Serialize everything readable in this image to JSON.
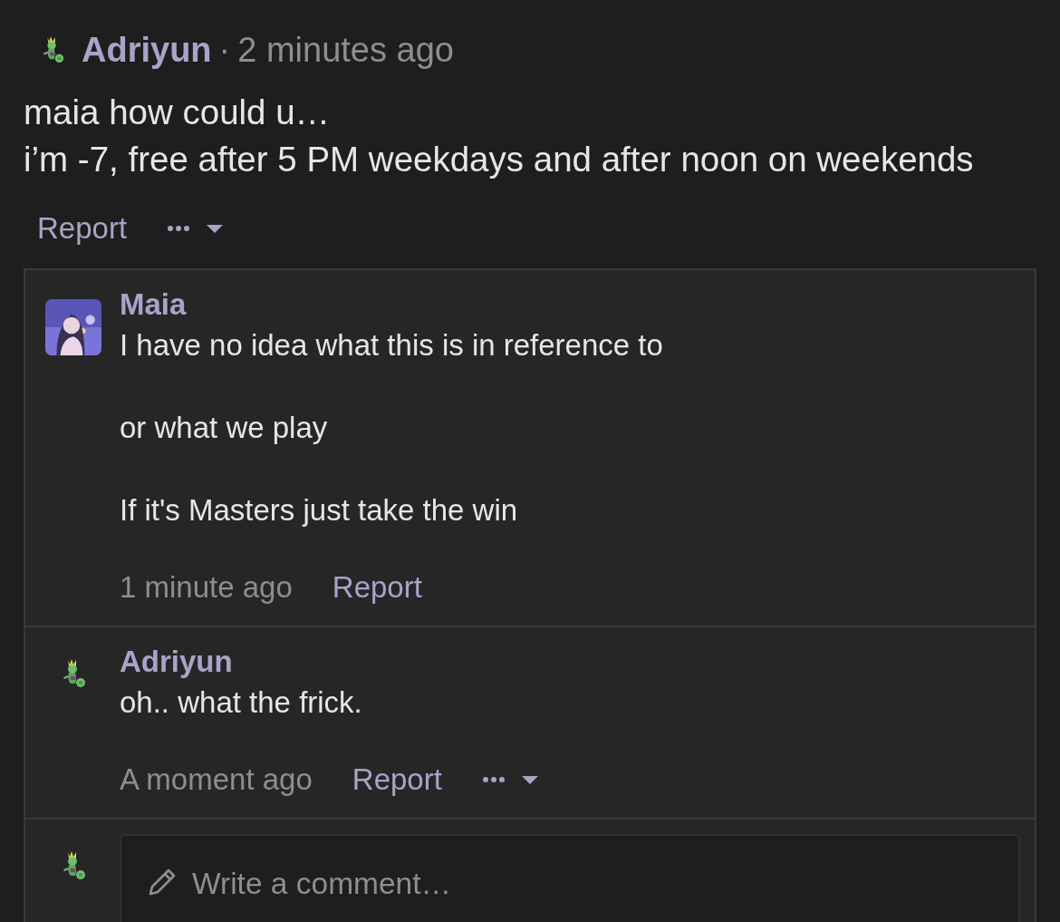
{
  "post": {
    "author": "Adriyun",
    "avatar": {
      "kind": "creature"
    },
    "separator": "·",
    "time": "2 minutes ago",
    "lines": [
      "maia how could u…",
      "i’m -7, free after 5 PM weekdays and after noon on weekends"
    ],
    "report": "Report",
    "more": true
  },
  "replies": [
    {
      "author": "Maia",
      "paragraphs": [
        "I have no idea what this is in reference to",
        "or what we play",
        "If it's Masters just take the win"
      ],
      "time": "1 minute ago",
      "report": "Report",
      "more": false
    },
    {
      "author": "Adriyun",
      "avatar": {
        "kind": "creature"
      },
      "paragraphs": [
        "oh.. what the frick."
      ],
      "time": "A moment ago",
      "report": "Report",
      "more": true
    }
  ],
  "composer": {
    "avatar": {
      "kind": "creature"
    },
    "placeholder": "Write a comment…"
  }
}
